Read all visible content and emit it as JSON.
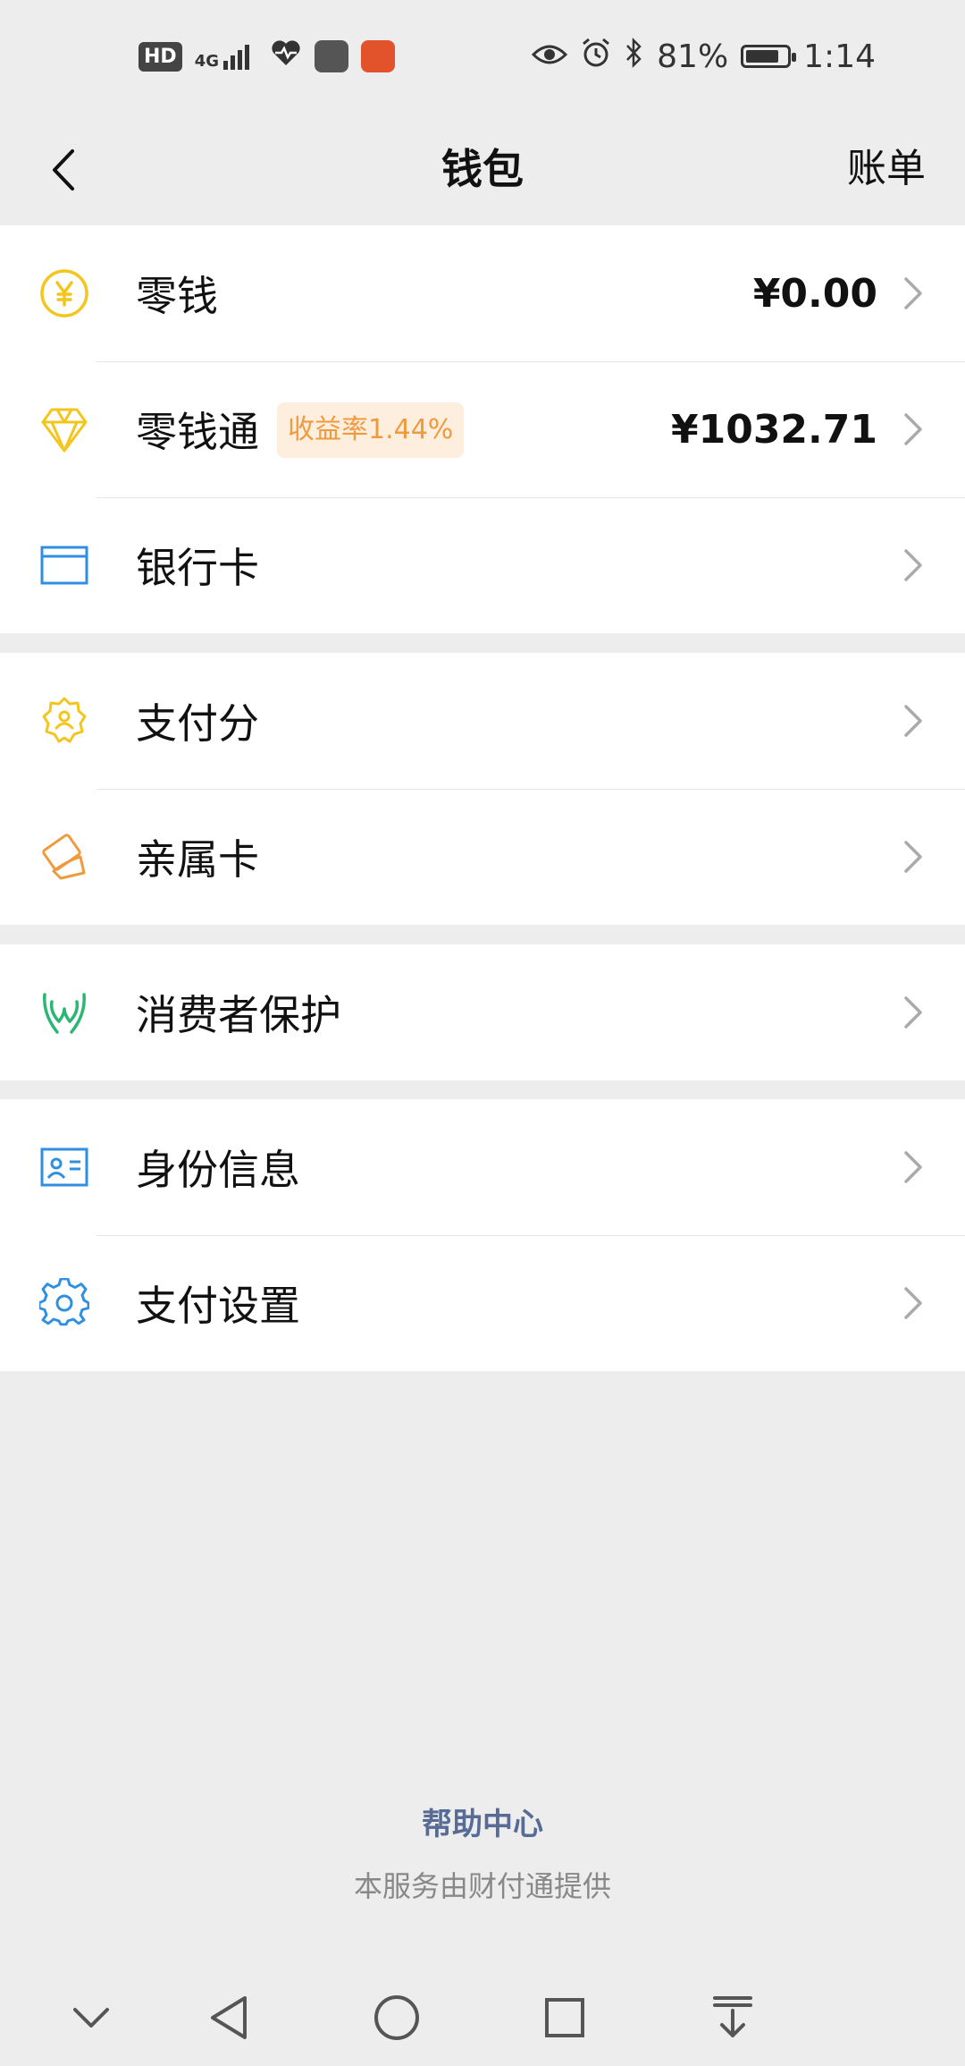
{
  "status_bar": {
    "hd_badge": "HD",
    "network": "4G",
    "battery_percent": "81%",
    "battery_level": 0.81,
    "time": "1:14",
    "icons": [
      "hd-icon",
      "signal-icon",
      "health-icon",
      "app-icon",
      "app-icon",
      "eye-icon",
      "alarm-icon",
      "bluetooth-icon",
      "battery-icon"
    ]
  },
  "header": {
    "title": "钱包",
    "right_action": "账单"
  },
  "groups": [
    {
      "rows": [
        {
          "icon": "yuan-coin-icon",
          "label": "零钱",
          "value": "¥0.00"
        },
        {
          "icon": "diamond-icon",
          "label": "零钱通",
          "tag": "收益率1.44%",
          "value": "¥1032.71"
        },
        {
          "icon": "bank-card-icon",
          "label": "银行卡",
          "value": ""
        }
      ]
    },
    {
      "rows": [
        {
          "icon": "pay-score-badge-icon",
          "label": "支付分"
        },
        {
          "icon": "family-card-icon",
          "label": "亲属卡"
        }
      ]
    },
    {
      "rows": [
        {
          "icon": "consumer-protection-icon",
          "label": "消费者保护"
        }
      ]
    },
    {
      "rows": [
        {
          "icon": "id-card-icon",
          "label": "身份信息"
        },
        {
          "icon": "gear-icon",
          "label": "支付设置"
        }
      ]
    }
  ],
  "footer": {
    "help_center": "帮助中心",
    "provider_note": "本服务由财付通提供"
  },
  "colors": {
    "background": "#ededed",
    "yellow": "#f4c51c",
    "orange": "#f09a3e",
    "blue": "#2f8fe0",
    "green": "#2ab673",
    "link": "#576b95"
  }
}
